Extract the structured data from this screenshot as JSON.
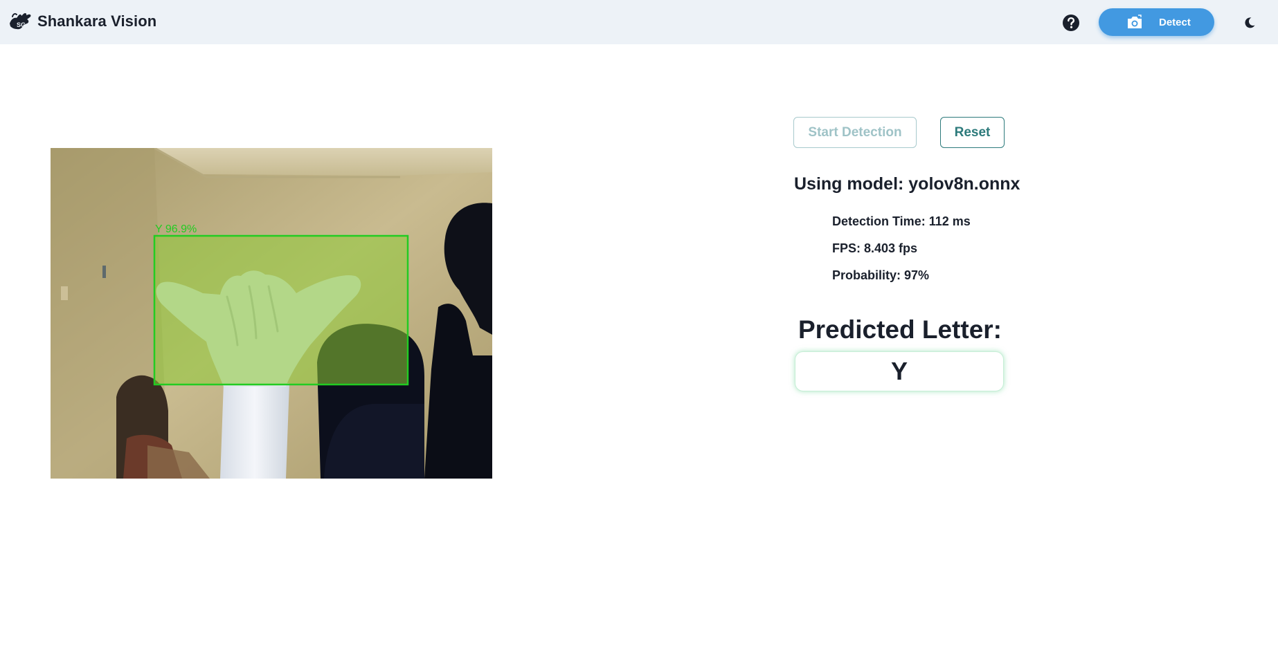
{
  "app": {
    "title": "Shankara Vision"
  },
  "navbar": {
    "help_icon": "question-circle-icon",
    "detect_label": "Detect",
    "detect_icon": "camera-icon",
    "theme_icon": "moon-icon",
    "colors": {
      "background": "#edf2f7",
      "detect_button": "#4299e1"
    }
  },
  "webcam": {
    "detection_label": "Y 96.9%",
    "box_color": "#22cc22"
  },
  "controls": {
    "start_label": "Start Detection",
    "start_disabled": true,
    "reset_label": "Reset"
  },
  "model": {
    "line": "Using model: yolov8n.onnx"
  },
  "stats": {
    "detection_time": "Detection Time: 112 ms",
    "fps": "FPS: 8.403 fps",
    "probability": "Probability: 97%"
  },
  "prediction": {
    "title": "Predicted Letter:",
    "letter": "Y"
  }
}
